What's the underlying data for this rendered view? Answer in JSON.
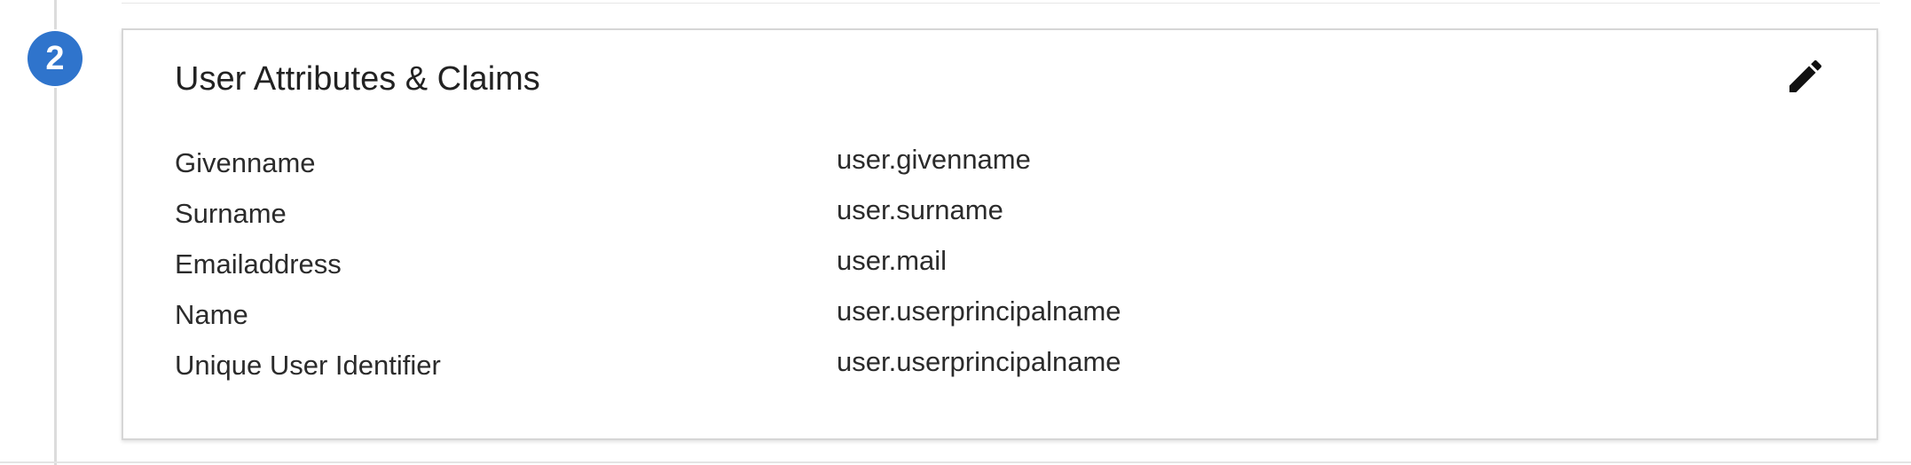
{
  "step": {
    "number": "2"
  },
  "section": {
    "title": "User Attributes & Claims",
    "edit_icon": "pencil-icon",
    "claims": [
      {
        "name": "Givenname",
        "value": "user.givenname"
      },
      {
        "name": "Surname",
        "value": "user.surname"
      },
      {
        "name": "Emailaddress",
        "value": "user.mail"
      },
      {
        "name": "Name",
        "value": "user.userprincipalname"
      },
      {
        "name": "Unique User Identifier",
        "value": "user.userprincipalname"
      }
    ]
  },
  "colors": {
    "step_badge": "#2f74cc",
    "text": "#2b2b2b",
    "border": "#d6d6d6"
  }
}
